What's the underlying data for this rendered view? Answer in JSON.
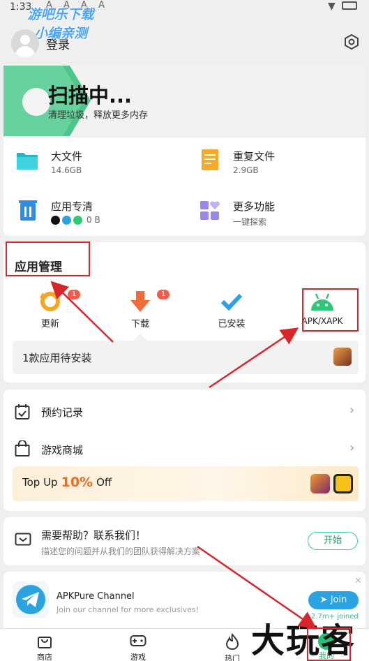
{
  "status_bar": {
    "time": "1:33"
  },
  "watermark": {
    "line1": "游吧乐下载",
    "line2": "小编亲测"
  },
  "header": {
    "login_label": "登录"
  },
  "scan": {
    "title": "扫描中...",
    "subtitle": "清理垃圾，释放更多内存"
  },
  "tools": [
    {
      "name": "大文件",
      "value": "14.6GB"
    },
    {
      "name": "重复文件",
      "value": "2.9GB"
    },
    {
      "name": "应用专清",
      "value": "0 B"
    },
    {
      "name": "更多功能",
      "value": "一键探索"
    }
  ],
  "app_manage": {
    "title": "应用管理",
    "items": [
      {
        "label": "更新",
        "badge": "1"
      },
      {
        "label": "下载",
        "badge": "1"
      },
      {
        "label": "已安装"
      },
      {
        "label": "APK/XAPK"
      }
    ],
    "pending": "1款应用待安装"
  },
  "menu": {
    "reserve": "预约记录",
    "shop": "游戏商城"
  },
  "topup": {
    "prefix": "Top Up",
    "percent": "10%",
    "suffix": "Off"
  },
  "help": {
    "title": "需要帮助？联系我们！",
    "desc": "描述您的问题并从我们的团队获得解决方案",
    "button": "开始"
  },
  "channel": {
    "title": "APKPure Channel",
    "desc": "Join our channel for more exclusives!",
    "button": "Join",
    "joined": "2.7m+ joined"
  },
  "bottom_nav": [
    "商店",
    "游戏",
    "热门",
    "我的"
  ],
  "overlay_text": "大玩客",
  "colors": {
    "accent": "#24c27a",
    "red_annot": "#d8262a",
    "topup_orange": "#f06a1f"
  }
}
